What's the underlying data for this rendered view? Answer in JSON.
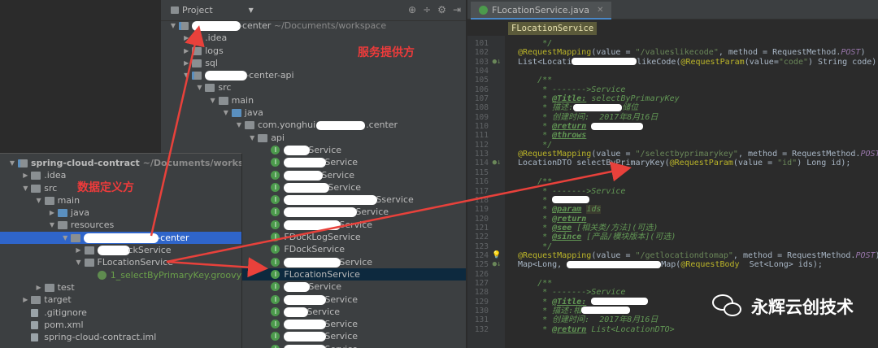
{
  "project_panel": {
    "title": "Project",
    "tree": [
      {
        "indent": 0,
        "arrow": "▼",
        "icon": "folder-mod",
        "label": "-center",
        "suffix": "~/Documents/workspace",
        "redact_before": 60
      },
      {
        "indent": 1,
        "arrow": "▶",
        "icon": "folder",
        "label": ".idea"
      },
      {
        "indent": 1,
        "arrow": "▶",
        "icon": "folder",
        "label": "logs"
      },
      {
        "indent": 1,
        "arrow": "▶",
        "icon": "folder",
        "label": "sql"
      },
      {
        "indent": 1,
        "arrow": "▼",
        "icon": "folder-mod",
        "label": "-center-api",
        "redact_before": 52
      },
      {
        "indent": 2,
        "arrow": "▼",
        "icon": "folder",
        "label": "src"
      },
      {
        "indent": 3,
        "arrow": "▼",
        "icon": "folder",
        "label": "main"
      },
      {
        "indent": 4,
        "arrow": "▼",
        "icon": "folder-blue",
        "label": "java"
      },
      {
        "indent": 5,
        "arrow": "▼",
        "icon": "folder",
        "label": "com.yonghui",
        "suffix_label": ".center",
        "redact_mid": 60
      },
      {
        "indent": 6,
        "arrow": "▼",
        "icon": "folder",
        "label": "api"
      },
      {
        "indent": 7,
        "icon": "cls",
        "label": "Service",
        "redact_before": 32
      },
      {
        "indent": 7,
        "icon": "cls",
        "label": "Service",
        "redact_before": 52
      },
      {
        "indent": 7,
        "icon": "cls",
        "label": "Service",
        "redact_before": 48
      },
      {
        "indent": 7,
        "icon": "cls",
        "label": "Service",
        "redact_before": 56
      },
      {
        "indent": 7,
        "icon": "cls",
        "label": "Sservice",
        "redact_before": 115
      },
      {
        "indent": 7,
        "icon": "cls",
        "label": "Service",
        "redact_before": 90
      },
      {
        "indent": 7,
        "icon": "cls",
        "label": "Service",
        "redact_before": 70
      },
      {
        "indent": 7,
        "icon": "cls",
        "label": "FDockLogService"
      },
      {
        "indent": 7,
        "icon": "cls",
        "label": "FDockService"
      },
      {
        "indent": 7,
        "icon": "cls",
        "label": "Service",
        "redact_before": 70
      },
      {
        "indent": 7,
        "icon": "cls",
        "label": "FLocationService",
        "selected": true
      },
      {
        "indent": 7,
        "icon": "cls",
        "label": "Service",
        "redact_before": 32
      },
      {
        "indent": 7,
        "icon": "cls",
        "label": "Service",
        "redact_before": 52
      },
      {
        "indent": 7,
        "icon": "cls",
        "label": "Service",
        "redact_before": 30
      },
      {
        "indent": 7,
        "icon": "cls",
        "label": "Service",
        "redact_before": 52
      },
      {
        "indent": 7,
        "icon": "cls",
        "label": "Service",
        "redact_before": 52
      },
      {
        "indent": 7,
        "icon": "cls",
        "label": "Service",
        "redact_before": 52
      }
    ]
  },
  "left_panel": {
    "tree": [
      {
        "indent": 0,
        "arrow": "▼",
        "icon": "folder-mod",
        "label": "spring-cloud-contract",
        "suffix": "~/Documents/workspace/sp",
        "bold": true
      },
      {
        "indent": 1,
        "arrow": "▶",
        "icon": "folder",
        "label": ".idea"
      },
      {
        "indent": 1,
        "arrow": "▼",
        "icon": "folder",
        "label": "src"
      },
      {
        "indent": 2,
        "arrow": "▼",
        "icon": "folder",
        "label": "main"
      },
      {
        "indent": 3,
        "arrow": "▶",
        "icon": "folder-blue",
        "label": "java"
      },
      {
        "indent": 3,
        "arrow": "▼",
        "icon": "folder",
        "label": "resources"
      },
      {
        "indent": 4,
        "arrow": "▼",
        "icon": "folder",
        "label": "-center",
        "redact_before": 92,
        "selected": true
      },
      {
        "indent": 5,
        "arrow": "▶",
        "icon": "folder",
        "label": "ckService",
        "redact_before": 40
      },
      {
        "indent": 5,
        "arrow": "▼",
        "icon": "folder",
        "label": "FLocationService"
      },
      {
        "indent": 6,
        "icon": "cls-g",
        "label": "1_selectByPrimaryKey.groovy",
        "green": true
      },
      {
        "indent": 2,
        "arrow": "▶",
        "icon": "folder",
        "label": "test"
      },
      {
        "indent": 1,
        "arrow": "▶",
        "icon": "folder",
        "label": "target"
      },
      {
        "indent": 1,
        "icon": "file",
        "label": ".gitignore"
      },
      {
        "indent": 1,
        "icon": "file",
        "label": "pom.xml"
      },
      {
        "indent": 1,
        "icon": "file",
        "label": "spring-cloud-contract.iml"
      }
    ]
  },
  "editor": {
    "tab_label": "FLocationService.java",
    "breadcrumb": "FLocationService",
    "lines": [
      {
        "n": "101",
        "html": "<span class='cm'>     */</span>"
      },
      {
        "n": "102",
        "html": "<span class='an'>@RequestMapping</span><span class='plain'>(value = </span><span class='str'>\"/valueslikecode\"</span><span class='plain'>, method = RequestMethod.</span><span class='field'>POST</span><span class='plain'>)</span>"
      },
      {
        "n": "103",
        "mk": "●↓",
        "html": "<span class='plain'>List&lt;Locati</span><span style='display:inline-block;width:80px;height:9px;background:#fff;border-radius:4px;vertical-align:middle'></span><span class='plain'>likeCode(</span><span class='an'>@RequestParam</span><span class='plain'>(value=</span><span class='str'>\"code\"</span><span class='plain'>) String code);</span>"
      },
      {
        "n": "104",
        "html": ""
      },
      {
        "n": "105",
        "html": "<span class='cm'>    /**</span>"
      },
      {
        "n": "106",
        "html": "<span class='cm'>     * ------->Service</span>"
      },
      {
        "n": "107",
        "html": "<span class='cm'>     * </span><span class='tag'>@Title:</span><span class='cm'> selectByPrimaryKey</span>"
      },
      {
        "n": "108",
        "html": "<span class='cm'>     * 描述:</span><span style='display:inline-block;width:60px;height:9px;background:#fff;border-radius:4px;vertical-align:middle'></span><span class='cm'>储位</span>"
      },
      {
        "n": "109",
        "html": "<span class='cm'>     * 创建时间:  2017年8月16日</span>"
      },
      {
        "n": "110",
        "html": "<span class='cm'>     * </span><span class='tag'>@return</span><span class='cm'> </span><span style='display:inline-block;width:64px;height:9px;background:#fff;border-radius:4px;vertical-align:middle'></span>"
      },
      {
        "n": "111",
        "html": "<span class='cm'>     * </span><span class='tag'>@throws</span>"
      },
      {
        "n": "112",
        "html": "<span class='cm'>     */</span>"
      },
      {
        "n": "113",
        "html": "<span class='an'>@RequestMapping</span><span class='plain'>(value = </span><span class='str'>\"/selectbyprimarykey\"</span><span class='plain'>, method = RequestMethod.</span><span class='field'>POST</span><span class='plain'>)</span>"
      },
      {
        "n": "114",
        "mk": "●↓",
        "html": "<span class='plain'>LocationDTO selectByPrimaryKey(</span><span class='an'>@RequestParam</span><span class='plain'>(value = </span><span class='str'>\"id\"</span><span class='plain'>) Long id);</span>"
      },
      {
        "n": "115",
        "html": ""
      },
      {
        "n": "116",
        "html": "<span class='cm'>    /**</span>"
      },
      {
        "n": "117",
        "html": "<span class='cm'>     * ------->Service</span>"
      },
      {
        "n": "118",
        "html": "<span class='cm'>     * </span><span style='display:inline-block;width:46px;height:9px;background:#fff;border-radius:4px;vertical-align:middle'></span>"
      },
      {
        "n": "119",
        "html": "<span class='cm'>     * </span><span class='tag'>@param</span><span class='cm'> </span><span class='cm tagbg'>ids</span>"
      },
      {
        "n": "120",
        "html": "<span class='cm'>     * </span><span class='tag'>@return</span>"
      },
      {
        "n": "121",
        "html": "<span class='cm'>     * </span><span class='tag'>@see</span><span class='cm'> [相关类/方法](可选)</span>"
      },
      {
        "n": "122",
        "html": "<span class='cm'>     * </span><span class='tag'>@since</span><span class='cm'> [产品/模块版本](可选)</span>"
      },
      {
        "n": "123",
        "html": "<span class='cm'>     */</span>"
      },
      {
        "n": "124",
        "mk": "💡",
        "html": "<span class='an'>@RequestMapping</span><span class='plain'>(value = </span><span class='str'>\"/getlocationdtomap\"</span><span class='plain'>, method = RequestMethod.</span><span class='field'>POST</span><span class='plain'>)</span>"
      },
      {
        "n": "125",
        "mk": "●↓",
        "html": "<span class='plain'>Map&lt;Long, </span><span style='display:inline-block;width:116px;height:9px;background:#fff;border-radius:4px;vertical-align:middle'></span><span class='plain'>Map(</span><span class='an'>@RequestBody</span><span class='plain'>  Set&lt;Long&gt; ids);</span>"
      },
      {
        "n": "126",
        "html": ""
      },
      {
        "n": "127",
        "html": "<span class='cm'>    /**</span>"
      },
      {
        "n": "128",
        "html": "<span class='cm'>     * ------->Service</span>"
      },
      {
        "n": "129",
        "html": "<span class='cm'>     * </span><span class='tag'>@Title:</span><span class='cm'> </span><span style='display:inline-block;width:70px;height:9px;background:#fff;border-radius:4px;vertical-align:middle'></span>"
      },
      {
        "n": "130",
        "html": "<span class='cm'>     * 描述:相</span><span style='display:inline-block;width:60px;height:9px;background:#fff;border-radius:4px;vertical-align:middle'></span>"
      },
      {
        "n": "131",
        "html": "<span class='cm'>     * 创建时间:  2017年8月16日</span>"
      },
      {
        "n": "132",
        "html": "<span class='cm'>     * </span><span class='tag'>@return</span><span class='cm'> List&lt;LocationDTO&gt;</span>"
      }
    ]
  },
  "annotations": {
    "provider": "服务提供方",
    "definer": "数据定义方"
  },
  "watermark": {
    "text": "永辉云创技术"
  },
  "colors": {
    "arrow": "#e8413b",
    "selection": "#2f65ca"
  }
}
